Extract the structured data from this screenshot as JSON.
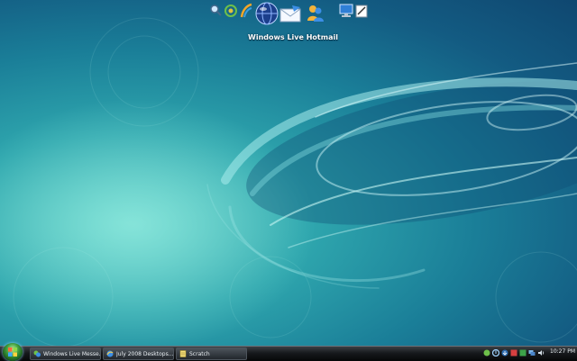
{
  "dock": {
    "active_label": "Windows Live Hotmail",
    "icons": [
      "search-icon",
      "messenger-icon",
      "feeds-icon",
      "globe-icon",
      "mail-icon",
      "contacts-icon",
      "computer-icon",
      "notepad-icon"
    ]
  },
  "taskbar": {
    "items": [
      {
        "label": "Windows Live Messe..."
      },
      {
        "label": "July 2008 Desktops..."
      },
      {
        "label": "Scratch"
      }
    ],
    "clock": "10:27 PM"
  },
  "colors": {
    "wallpaper_light": "#5fd0c6",
    "wallpaper_dark": "#0f4770",
    "taskbar": "#16191c"
  }
}
